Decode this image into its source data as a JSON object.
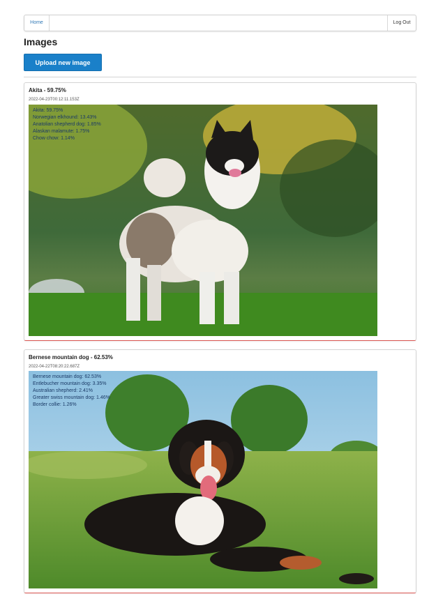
{
  "nav": {
    "home": "Home",
    "logout": "Log Out"
  },
  "page": {
    "title": "Images",
    "upload_label": "Upload new image"
  },
  "cards": [
    {
      "title": "Akita - 59.75%",
      "timestamp": "2022-04-23T00:12:11.153Z",
      "predictions": [
        "Akita: 59.75%",
        "Norwegian elkhound: 13.43%",
        "Anatolian shepherd dog: 1.85%",
        "Alaskan malamute: 1.75%",
        "Chow chow: 1.14%"
      ]
    },
    {
      "title": "Bernese mountain dog - 62.53%",
      "timestamp": "2022-04-22T08:20:22.687Z",
      "predictions": [
        "Bernese mountain dog: 62.53%",
        "Entlebucher mountain dog: 3.35%",
        "Australian shepherd: 2.41%",
        "Greater swiss mountain dog: 1.46%",
        "Border collie: 1.26%"
      ]
    }
  ]
}
